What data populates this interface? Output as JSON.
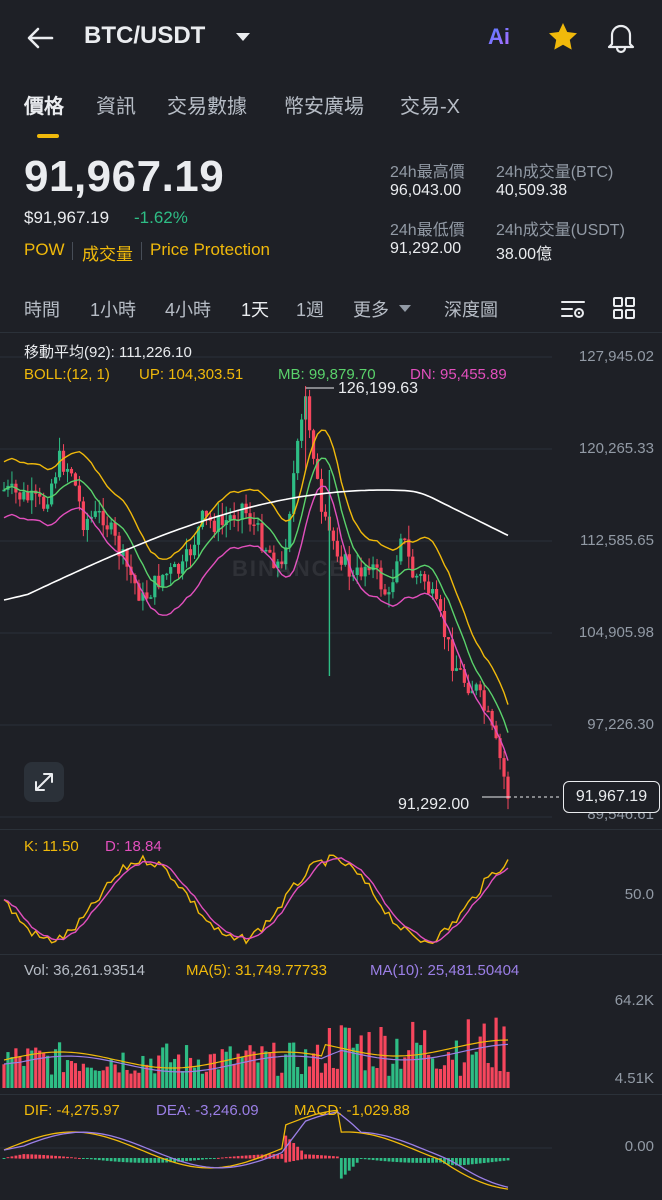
{
  "header": {
    "pair": "BTC/USDT",
    "icons": {
      "back": "arrow-left-icon",
      "ai": "ai-icon",
      "star": "star-icon",
      "bell": "bell-icon"
    },
    "ai_label": "Ai",
    "colors": {
      "star": "#f0b90b",
      "ai": "#7b6cf6"
    }
  },
  "tabs": [
    {
      "label": "價格",
      "active": true
    },
    {
      "label": "資訊",
      "active": false
    },
    {
      "label": "交易數據",
      "active": false
    },
    {
      "label": "幣安廣場",
      "active": false
    },
    {
      "label": "交易-X",
      "active": false
    }
  ],
  "ticker": {
    "price": "91,967.19",
    "usd_price": "$91,967.19",
    "change_pct": "-1.62%",
    "tags": [
      "POW",
      "成交量",
      "Price Protection"
    ],
    "stats": {
      "high_label": "24h最高價",
      "high_value": "96,043.00",
      "vol_btc_label": "24h成交量(BTC)",
      "vol_btc_value": "40,509.38",
      "low_label": "24h最低價",
      "low_value": "91,292.00",
      "vol_usdt_label": "24h成交量(USDT)",
      "vol_usdt_value": "38.00億"
    }
  },
  "timeframes": [
    {
      "label": "時間",
      "active": false
    },
    {
      "label": "1小時",
      "active": false
    },
    {
      "label": "4小時",
      "active": false
    },
    {
      "label": "1天",
      "active": true
    },
    {
      "label": "1週",
      "active": false
    },
    {
      "label": "更多",
      "active": false
    },
    {
      "label": "深度圖",
      "active": false
    }
  ],
  "main_chart": {
    "ma_label": "移動平均(92): 111,226.10",
    "boll": {
      "label": "BOLL:(12, 1)",
      "up": "UP: 104,303.51",
      "mb": "MB: 99,879.70",
      "dn": "DN: 95,455.89"
    },
    "y_ticks": [
      "127,945.02",
      "120,265.33",
      "112,585.65",
      "104,905.98",
      "97,226.30",
      "89,546.61"
    ],
    "high_annotation": "126,199.63",
    "low_annotation": "91,292.00",
    "current_price_tag": "91,967.19",
    "watermark": "BINANCE",
    "colors": {
      "up": "#2ebd85",
      "down": "#f6465d",
      "ma": "#ffffff",
      "boll_up": "#f0b90b",
      "boll_mb": "#5ad26b",
      "boll_dn": "#e24fbd"
    }
  },
  "kdj": {
    "k": "K: 11.50",
    "d": "D: 18.84",
    "tick": "50.0",
    "colors": {
      "k": "#f0b90b",
      "d": "#e24fbd"
    }
  },
  "volume": {
    "vol": "Vol: 36,261.93514",
    "ma5": "MA(5): 31,749.77733",
    "ma10": "MA(10): 25,481.50404",
    "ticks": [
      "64.2K",
      "4.51K"
    ],
    "colors": {
      "ma5": "#f0b90b",
      "ma10": "#9b7fe6"
    }
  },
  "macd": {
    "dif": "DIF: -4,275.97",
    "dea": "DEA: -3,246.09",
    "macd": "MACD: -1,029.88",
    "tick": "0.00",
    "colors": {
      "dif": "#f0b90b",
      "dea": "#9b7fe6"
    }
  }
}
